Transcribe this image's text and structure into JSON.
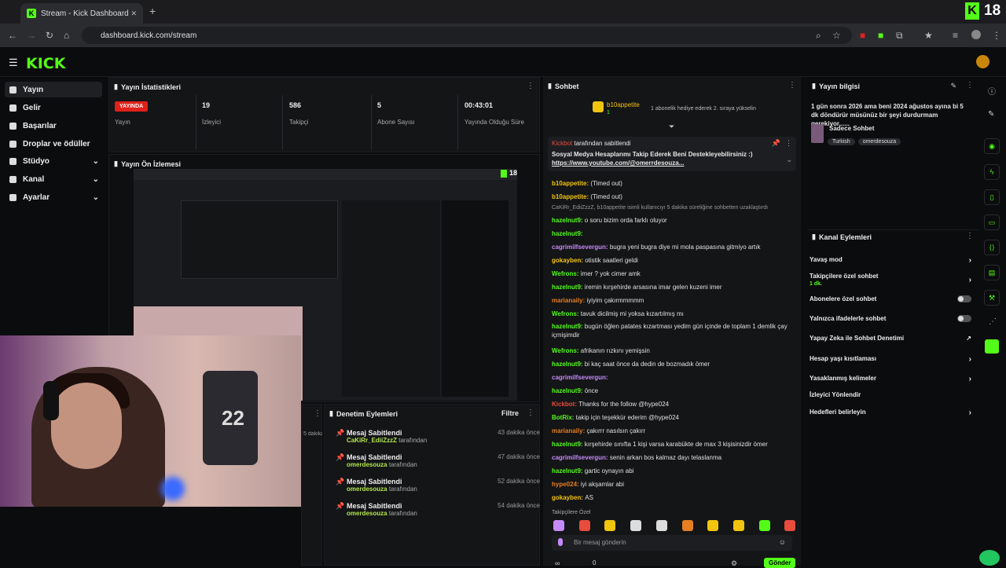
{
  "browser": {
    "tab_title": "Stream - Kick Dashboard",
    "url": "dashboard.kick.com/stream",
    "new_tab": "+",
    "close_tab": "✕",
    "badge": "18"
  },
  "brand": {
    "logo": "KICK",
    "accent": "#53fc18"
  },
  "sidebar": {
    "items": [
      {
        "label": "Yayın",
        "icon": "broadcast-icon"
      },
      {
        "label": "Gelir",
        "icon": "money-icon"
      },
      {
        "label": "Başarılar",
        "icon": "trophy-icon"
      },
      {
        "label": "Droplar ve ödüller",
        "icon": "gift-icon"
      },
      {
        "label": "Stüdyo",
        "icon": "studio-icon"
      },
      {
        "label": "Kanal",
        "icon": "channel-icon"
      },
      {
        "label": "Ayarlar",
        "icon": "gear-icon"
      }
    ]
  },
  "stats": {
    "title": "Yayın İstatistikleri",
    "live_badge": "YAYINDA",
    "live_label": "Yayın",
    "viewers": {
      "value": "19",
      "label": "İzleyici"
    },
    "followers": {
      "value": "586",
      "label": "Takipçi"
    },
    "subs": {
      "value": "5",
      "label": "Abone Sayısı"
    },
    "uptime": {
      "value": "00:43:01",
      "label": "Yayında Olduğu Süre"
    }
  },
  "preview": {
    "title": "Yayın Ön İzlemesi",
    "badge": "18"
  },
  "mod_actions": {
    "title": "Denetim Eylemleri",
    "filter": "Filtre",
    "side_time": "5 dakika önce",
    "items": [
      {
        "title": "Mesaj Sabitlendi",
        "user": "CaKiRr_EdiiZzzZ",
        "by": "tarafından",
        "time": "43 dakika önce"
      },
      {
        "title": "Mesaj Sabitlendi",
        "user": "omerdesouza",
        "by": "tarafından",
        "time": "47 dakika önce"
      },
      {
        "title": "Mesaj Sabitlendi",
        "user": "omerdesouza",
        "by": "tarafından",
        "time": "52 dakika önce"
      },
      {
        "title": "Mesaj Sabitlendi",
        "user": "omerdesouza",
        "by": "tarafından",
        "time": "54 dakika önce"
      }
    ]
  },
  "chat": {
    "title": "Sohbet",
    "gift_user": "b10appetite",
    "gift_count": "1",
    "gift_text": "1 abonelik hediye ederek 2. sıraya yükselin",
    "pinned_by_user": "Kickbot",
    "pinned_by": "tarafından sabitlendi",
    "pinned_text": "Sosyal Medya Hesaplarımı Takip Ederek Beni Destekleyebilirsiniz :)",
    "pinned_link": "https://www.youtube.com/@omerrdesouza...",
    "messages": [
      {
        "user": "b10appetite",
        "text": "(Timed out)",
        "color": "y"
      },
      {
        "user": "b10appetite",
        "text": "(Timed out)",
        "color": "y"
      },
      {
        "user": "",
        "text": "CaKiRr_EdiiZzzZ, b10appetite isimli kullanıcıyı 5 dakika süreliğine sohbetten uzaklaştırdı",
        "color": ""
      },
      {
        "user": "hazelnut9",
        "text": "o soru bizim orda farklı oluyor",
        "color": "g"
      },
      {
        "user": "hazelnut9",
        "text": "",
        "color": "g"
      },
      {
        "user": "cagrimilfsevergun",
        "text": "bugra yeni bugra diye mi mola paspasına gitmiyo artık",
        "color": "p"
      },
      {
        "user": "gokayben",
        "text": "otistik saatleri geldi",
        "color": "y"
      },
      {
        "user": "Wefrons",
        "text": "imer ? yok cimer amk",
        "color": "g"
      },
      {
        "user": "hazelnut9",
        "text": "iremin kırşehirde arsasına imar gelen kuzeni imer",
        "color": "g"
      },
      {
        "user": "marianaily",
        "text": "iyiyim çakırmmmmm",
        "color": "o"
      },
      {
        "user": "Wefrons",
        "text": "tavuk dicilmiş mi yoksa kızartılmış mı",
        "color": "g"
      },
      {
        "user": "hazelnut9",
        "text": "bugün öğlen patates kızartması yedim gün içinde de toplam 1 demlik çay içmişimdir",
        "color": "g"
      },
      {
        "user": "Wefrons",
        "text": "afrikanın rızkını yemişsin",
        "color": "g"
      },
      {
        "user": "hazelnut9",
        "text": "bi kaç saat önce da dedin de bozmadık ömer",
        "color": "g"
      },
      {
        "user": "cagrimilfsevergun",
        "text": "",
        "color": "p"
      },
      {
        "user": "hazelnut9",
        "text": "önce",
        "color": "g"
      },
      {
        "user": "Kickbot",
        "text": "Thanks for the follow @hype024",
        "color": "r"
      },
      {
        "user": "BotRix",
        "text": "takip için teşekkür ederim @hype024",
        "color": "g"
      },
      {
        "user": "marianaily",
        "text": "çakırrr nasılsın çakırr",
        "color": "o"
      },
      {
        "user": "hazelnut9",
        "text": "kırşehirde sınıfta 1 kişi varsa karabükte de max 3 kişisinizdir ömer",
        "color": "g"
      },
      {
        "user": "cagrimilfsevergun",
        "text": "senin arkan bos kalmaz dayı telaslanma",
        "color": "p"
      },
      {
        "user": "hazelnut9",
        "text": "gartic oynayın abi",
        "color": "g"
      },
      {
        "user": "hype024",
        "text": "iyi akşamlar abi",
        "color": "o"
      },
      {
        "user": "gokayben",
        "text": "AS",
        "color": "y"
      }
    ],
    "followers_label": "Takipçilere Özel",
    "input_placeholder": "Bir mesaj gönderin",
    "send": "Gönder",
    "bottom_count": "0"
  },
  "stream_info": {
    "title": "Yayın bilgisi",
    "description": "1 gün sonra 2026 ama beni 2024 ağustos ayına bi 5 dk döndürür müsünüz bir şeyi durdurmam gerekiyor......",
    "category": "Sadece Sohbet",
    "tags": [
      "Turkish",
      "omerdesouza"
    ]
  },
  "channel_actions": {
    "title": "Kanal Eylemleri",
    "items": [
      {
        "label": "Yavaş mod",
        "type": "arrow"
      },
      {
        "label": "Takipçilere özel sohbet",
        "sub": "1 dk.",
        "type": "arrow"
      },
      {
        "label": "Abonelere özel sohbet",
        "type": "toggle"
      },
      {
        "label": "Yalnızca ifadelerle sohbet",
        "type": "toggle"
      },
      {
        "label": "Yapay Zeka ile Sohbet Denetimi",
        "type": "link"
      },
      {
        "label": "Hesap yaşı kısıtlaması",
        "type": "arrow"
      },
      {
        "label": "Yasaklanmış kelimeler",
        "type": "arrow"
      },
      {
        "label": "İzleyici Yönlendir",
        "type": "none"
      },
      {
        "label": "Hedefleri belirleyin",
        "type": "arrow"
      }
    ]
  }
}
